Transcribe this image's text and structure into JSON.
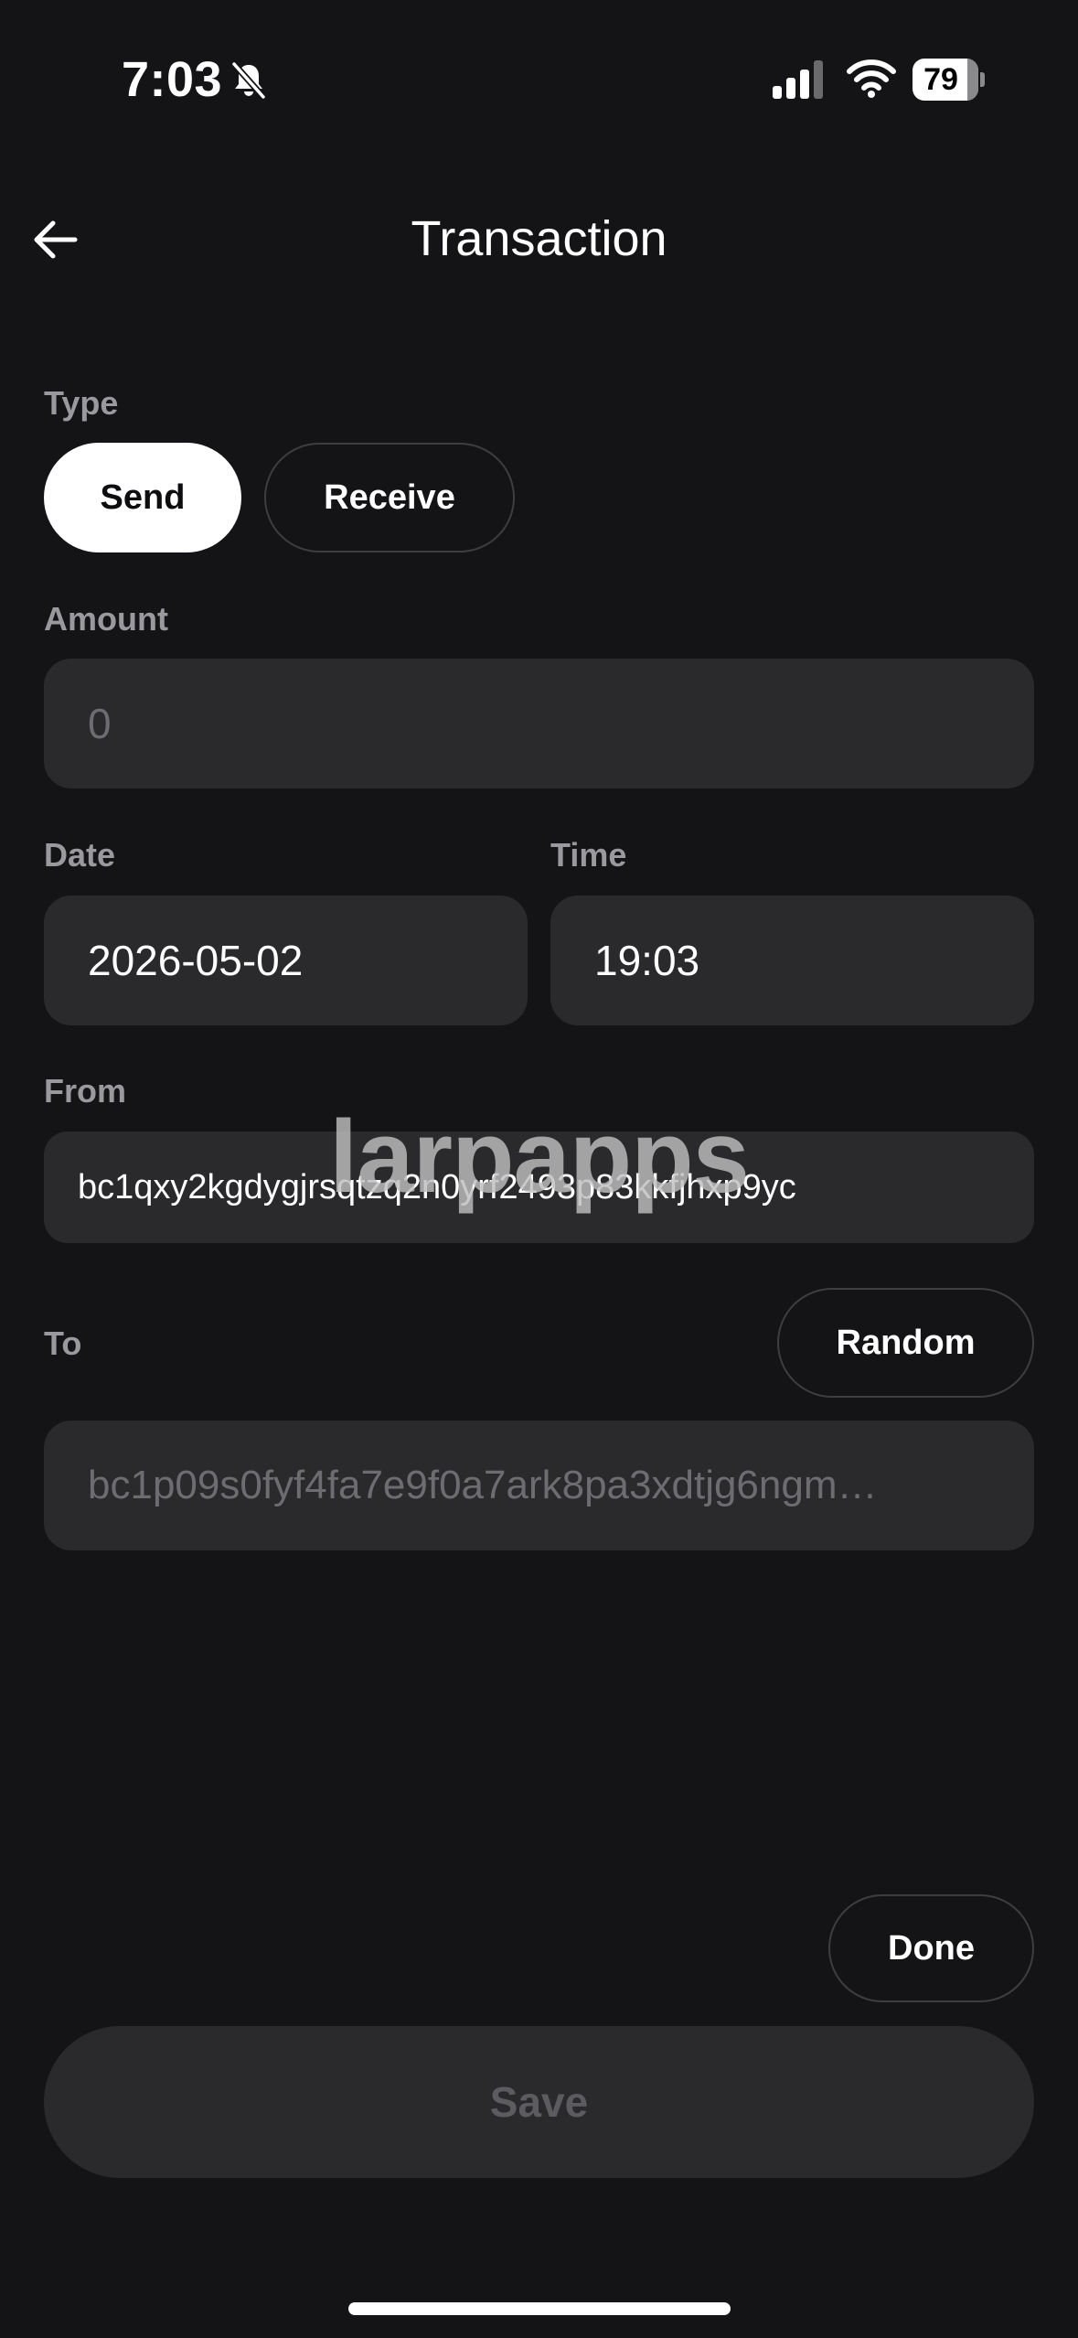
{
  "status_bar": {
    "time": "7:03",
    "battery": "79"
  },
  "header": {
    "title": "Transaction"
  },
  "type_section": {
    "label": "Type",
    "options": [
      "Send",
      "Receive"
    ],
    "selected": "Send"
  },
  "amount": {
    "label": "Amount",
    "placeholder": "0"
  },
  "date": {
    "label": "Date",
    "value": "2026-05-02"
  },
  "time": {
    "label": "Time",
    "value": "19:03"
  },
  "from": {
    "label": "From",
    "value": "bc1qxy2kgdygjrsqtzq2n0yrf2493p83kkfjhxp9yc"
  },
  "to": {
    "label": "To",
    "random_label": "Random",
    "placeholder": "bc1p09s0fyf4fa7e9f0a7ark8pa3xdtjg6ngm…"
  },
  "watermark": "larpapps",
  "done_label": "Done",
  "save_label": "Save"
}
